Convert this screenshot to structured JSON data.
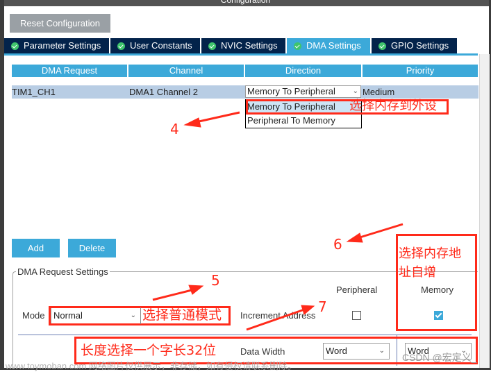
{
  "window": {
    "title": "Configuration"
  },
  "toolbar": {
    "reset_label": "Reset Configuration"
  },
  "tabs": [
    {
      "label": "Parameter Settings",
      "icon": "check-circle-icon",
      "active": false
    },
    {
      "label": "User Constants",
      "icon": "check-circle-icon",
      "active": false
    },
    {
      "label": "NVIC Settings",
      "icon": "check-circle-icon",
      "active": false
    },
    {
      "label": "DMA Settings",
      "icon": "check-circle-icon",
      "active": true
    },
    {
      "label": "GPIO Settings",
      "icon": "check-circle-icon",
      "active": false
    }
  ],
  "dma_table": {
    "headers": [
      "DMA Request",
      "Channel",
      "Direction",
      "Priority"
    ],
    "rows": [
      {
        "request": "TIM1_CH1",
        "channel": "DMA1 Channel 2",
        "direction": "Memory To Peripheral",
        "priority": "Medium"
      }
    ],
    "direction_options": [
      "Memory To Peripheral",
      "Peripheral To Memory"
    ],
    "direction_highlighted": "Memory To Peripheral"
  },
  "actions": {
    "add_label": "Add",
    "delete_label": "Delete"
  },
  "request_settings": {
    "legend": "DMA Request Settings",
    "mode_label": "Mode",
    "mode_value": "Normal",
    "column_peripheral": "Peripheral",
    "column_memory": "Memory",
    "increment_label": "Increment Address",
    "increment_peripheral": false,
    "increment_memory": true,
    "data_width_label": "Data Width",
    "data_width_peripheral": "Word",
    "data_width_memory": "Word"
  },
  "annotations": {
    "n4": "4",
    "n5": "5",
    "n6": "6",
    "n7": "7",
    "direction_note": "选择内存到外设",
    "mode_note": "选择普通模式",
    "memory_note_line1": "选择内存地",
    "memory_note_line2": "址自增",
    "width_note": "长度选择一个字长32位",
    "color": "#ff2a1a"
  },
  "watermarks": {
    "site": "www.toymoban.com 网络图片仅供展示，非存储，如有侵权请联系删除。",
    "author": "CSDN @宏定义_"
  },
  "colors": {
    "tab_dark": "#03234b",
    "tab_active": "#3ca9d9",
    "row_selected": "#b8cde4",
    "check_green": "#3fc46d"
  }
}
